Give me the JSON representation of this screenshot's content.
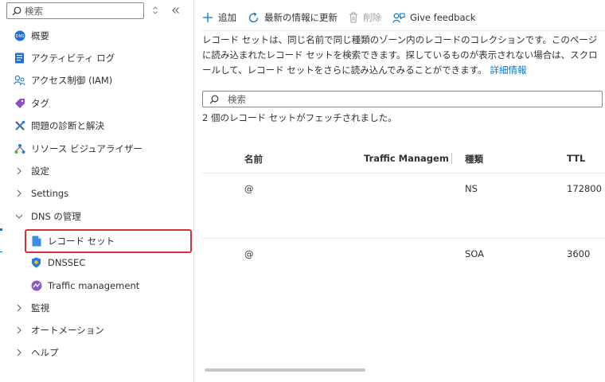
{
  "colors": {
    "accent": "#0078d4",
    "highlight": "#d13438",
    "disabled": "#a19f9d"
  },
  "sidebar": {
    "search": {
      "placeholder": "検索",
      "value": ""
    },
    "items": [
      {
        "label": "概要",
        "icon": "overview-icon"
      },
      {
        "label": "アクティビティ ログ",
        "icon": "activity-log-icon"
      },
      {
        "label": "アクセス制御 (IAM)",
        "icon": "access-control-icon"
      },
      {
        "label": "タグ",
        "icon": "tag-icon"
      },
      {
        "label": "問題の診断と解決",
        "icon": "diagnose-icon"
      },
      {
        "label": "リソース ビジュアライザー",
        "icon": "resource-visualizer-icon"
      },
      {
        "label": "設定",
        "icon": "chevron-right-icon"
      },
      {
        "label": "Settings",
        "icon": "chevron-right-icon"
      },
      {
        "label": "DNS の管理",
        "icon": "chevron-down-icon"
      },
      {
        "label": "レコード セット",
        "icon": "record-set-icon"
      },
      {
        "label": "DNSSEC",
        "icon": "dnssec-shield-icon"
      },
      {
        "label": "Traffic management",
        "icon": "traffic-management-icon"
      },
      {
        "label": "監視",
        "icon": "chevron-right-icon"
      },
      {
        "label": "オートメーション",
        "icon": "chevron-right-icon"
      },
      {
        "label": "ヘルプ",
        "icon": "chevron-right-icon"
      }
    ]
  },
  "toolbar": {
    "add_label": "追加",
    "refresh_label": "最新の情報に更新",
    "delete_label": "削除",
    "feedback_label": "Give feedback"
  },
  "main": {
    "description": "レコード セットは、同じ名前で同じ種類のゾーン内のレコードのコレクションです。このページに読み込まれたレコード セットを検索できます。探しているものが表示されない場合は、スクロールして、レコード セットをさらに読み込んでみることができます。",
    "details_link": "詳細情報",
    "search": {
      "placeholder": "検索",
      "value": ""
    },
    "fetch_status": "2 個のレコード セットがフェッチされました。"
  },
  "table": {
    "columns": [
      "名前",
      "Traffic Management",
      "種類",
      "TTL"
    ],
    "rows": [
      {
        "name": "@",
        "traffic": "",
        "type": "NS",
        "ttl": "172800"
      },
      {
        "name": "@",
        "traffic": "",
        "type": "SOA",
        "ttl": "3600"
      }
    ]
  },
  "scrollbar": {
    "thumb_fraction": 0.4
  }
}
